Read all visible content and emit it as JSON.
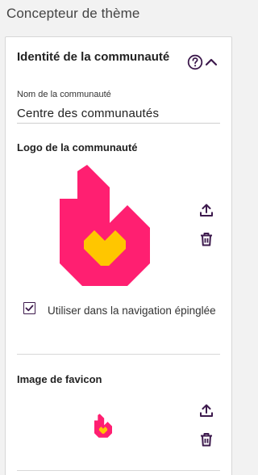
{
  "page": {
    "title": "Concepteur de thème"
  },
  "identity_section": {
    "title": "Identité de la communauté",
    "icons": {
      "help": "help-circle-icon",
      "collapse": "chevron-up-icon"
    },
    "name_field": {
      "label": "Nom de la communauté",
      "value": "Centre des communautés"
    },
    "logo": {
      "title": "Logo de la communauté",
      "image": "flame-heart-logo",
      "actions": {
        "upload": "upload-icon",
        "delete": "trash-icon"
      },
      "pinned_nav_checkbox": {
        "label": "Utiliser dans la navigation épinglée",
        "checked": true
      }
    },
    "favicon": {
      "title": "Image de favicon",
      "image": "flame-heart-favicon",
      "actions": {
        "upload": "upload-icon",
        "delete": "trash-icon"
      }
    }
  },
  "colors": {
    "accent": "#3d1a4d",
    "logo_flame": "#ff1f71",
    "logo_heart": "#ffc600"
  }
}
